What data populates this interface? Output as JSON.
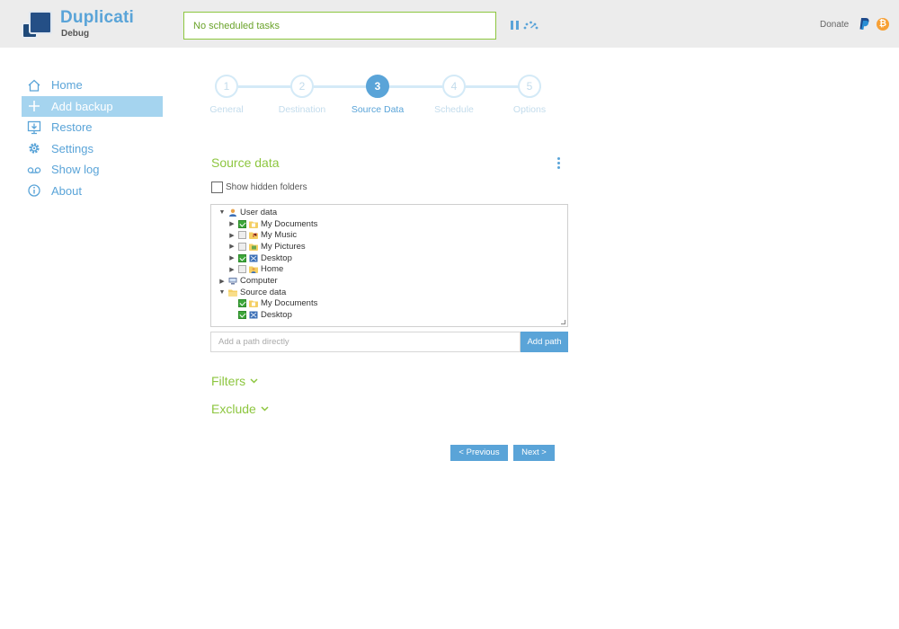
{
  "header": {
    "brand": "Duplicati",
    "brand_sub": "Debug",
    "status_text": "No scheduled tasks",
    "donate_label": "Donate",
    "icons": [
      "pause-icon",
      "throttle-icon",
      "paypal-icon",
      "bitcoin-icon"
    ],
    "colors": {
      "accent": "#5aa4d8",
      "green": "#8dc63f",
      "header_bg": "#ececec"
    }
  },
  "sidebar": {
    "items": [
      {
        "label": "Home",
        "icon": "home-icon",
        "active": false
      },
      {
        "label": "Add backup",
        "icon": "plus-icon",
        "active": true
      },
      {
        "label": "Restore",
        "icon": "restore-icon",
        "active": false
      },
      {
        "label": "Settings",
        "icon": "gear-icon",
        "active": false
      },
      {
        "label": "Show log",
        "icon": "log-icon",
        "active": false
      },
      {
        "label": "About",
        "icon": "info-icon",
        "active": false
      }
    ]
  },
  "wizard": {
    "current_step": 3,
    "steps": [
      {
        "number": "1",
        "label": "General"
      },
      {
        "number": "2",
        "label": "Destination"
      },
      {
        "number": "3",
        "label": "Source Data"
      },
      {
        "number": "4",
        "label": "Schedule"
      },
      {
        "number": "5",
        "label": "Options"
      }
    ]
  },
  "source": {
    "title": "Source data",
    "show_hidden_label": "Show hidden folders",
    "show_hidden_checked": false,
    "tree": [
      {
        "label": "User data",
        "level": 0,
        "arrow": "down",
        "checkbox": "none",
        "icon": "user-icon"
      },
      {
        "label": "My Documents",
        "level": 1,
        "arrow": "right",
        "checkbox": "checked",
        "icon": "documents-folder-icon"
      },
      {
        "label": "My Music",
        "level": 1,
        "arrow": "right",
        "checkbox": "unchecked",
        "icon": "music-folder-icon"
      },
      {
        "label": "My Pictures",
        "level": 1,
        "arrow": "right",
        "checkbox": "unchecked",
        "icon": "pictures-folder-icon"
      },
      {
        "label": "Desktop",
        "level": 1,
        "arrow": "right",
        "checkbox": "checked",
        "icon": "desktop-icon"
      },
      {
        "label": "Home",
        "level": 1,
        "arrow": "right",
        "checkbox": "unchecked",
        "icon": "home-folder-icon"
      },
      {
        "label": "Computer",
        "level": 0,
        "arrow": "right",
        "checkbox": "none",
        "icon": "computer-icon"
      },
      {
        "label": "Source data",
        "level": 0,
        "arrow": "down",
        "checkbox": "none",
        "icon": "folder-icon"
      },
      {
        "label": "My Documents",
        "level": 1,
        "arrow": "none",
        "checkbox": "checked",
        "icon": "documents-folder-icon"
      },
      {
        "label": "Desktop",
        "level": 1,
        "arrow": "none",
        "checkbox": "checked",
        "icon": "desktop-icon"
      }
    ],
    "path_placeholder": "Add a path directly",
    "path_value": "",
    "add_path_label": "Add path"
  },
  "filters_label": "Filters",
  "exclude_label": "Exclude",
  "footer": {
    "previous_label": "< Previous",
    "next_label": "Next >"
  }
}
